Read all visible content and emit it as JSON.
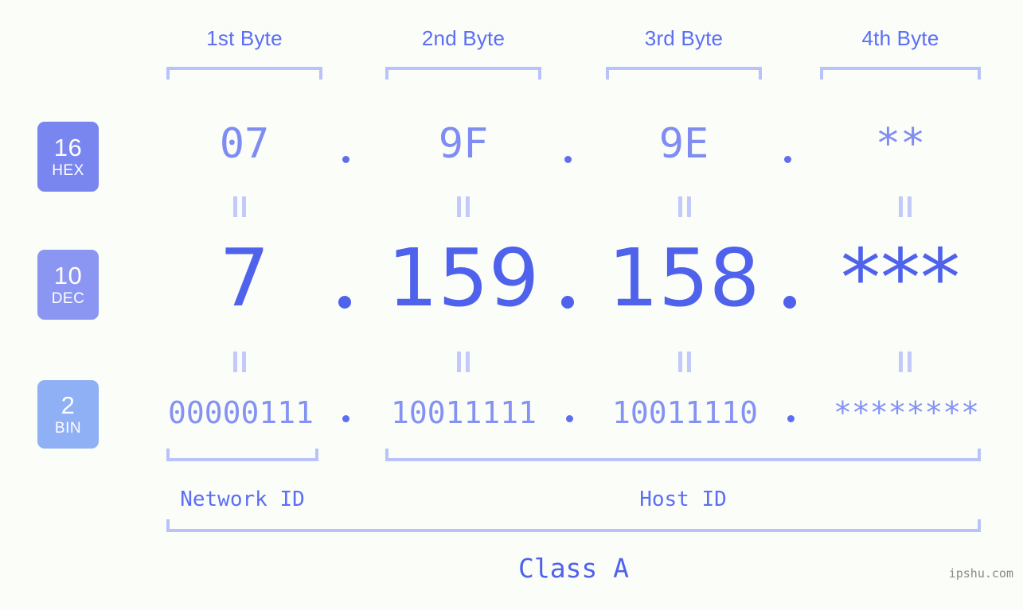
{
  "background_color": "#fbfdf8",
  "accent_color": "#5b6ef5",
  "bracket_color": "#b9c2fb",
  "byte_headers": [
    {
      "label": "1st Byte"
    },
    {
      "label": "2nd Byte"
    },
    {
      "label": "3rd Byte"
    },
    {
      "label": "4th Byte"
    }
  ],
  "bases": [
    {
      "number": "16",
      "name": "HEX",
      "color": "#7986f0"
    },
    {
      "number": "10",
      "name": "DEC",
      "color": "#8b96f2"
    },
    {
      "number": "2",
      "name": "BIN",
      "color": "#8fb0f5"
    }
  ],
  "rows": {
    "hex": {
      "b1": "07",
      "b2": "9F",
      "b3": "9E",
      "b4": "**"
    },
    "dec": {
      "b1": "7",
      "b2": "159",
      "b3": "158",
      "b4": "***"
    },
    "bin": {
      "b1": "00000111",
      "b2": "10011111",
      "b3": "10011110",
      "b4": "********"
    }
  },
  "separator": ".",
  "equivalence_mark": "||",
  "footer": {
    "network_id_label": "Network ID",
    "host_id_label": "Host ID",
    "class_label": "Class A"
  },
  "watermark": "ipshu.com"
}
